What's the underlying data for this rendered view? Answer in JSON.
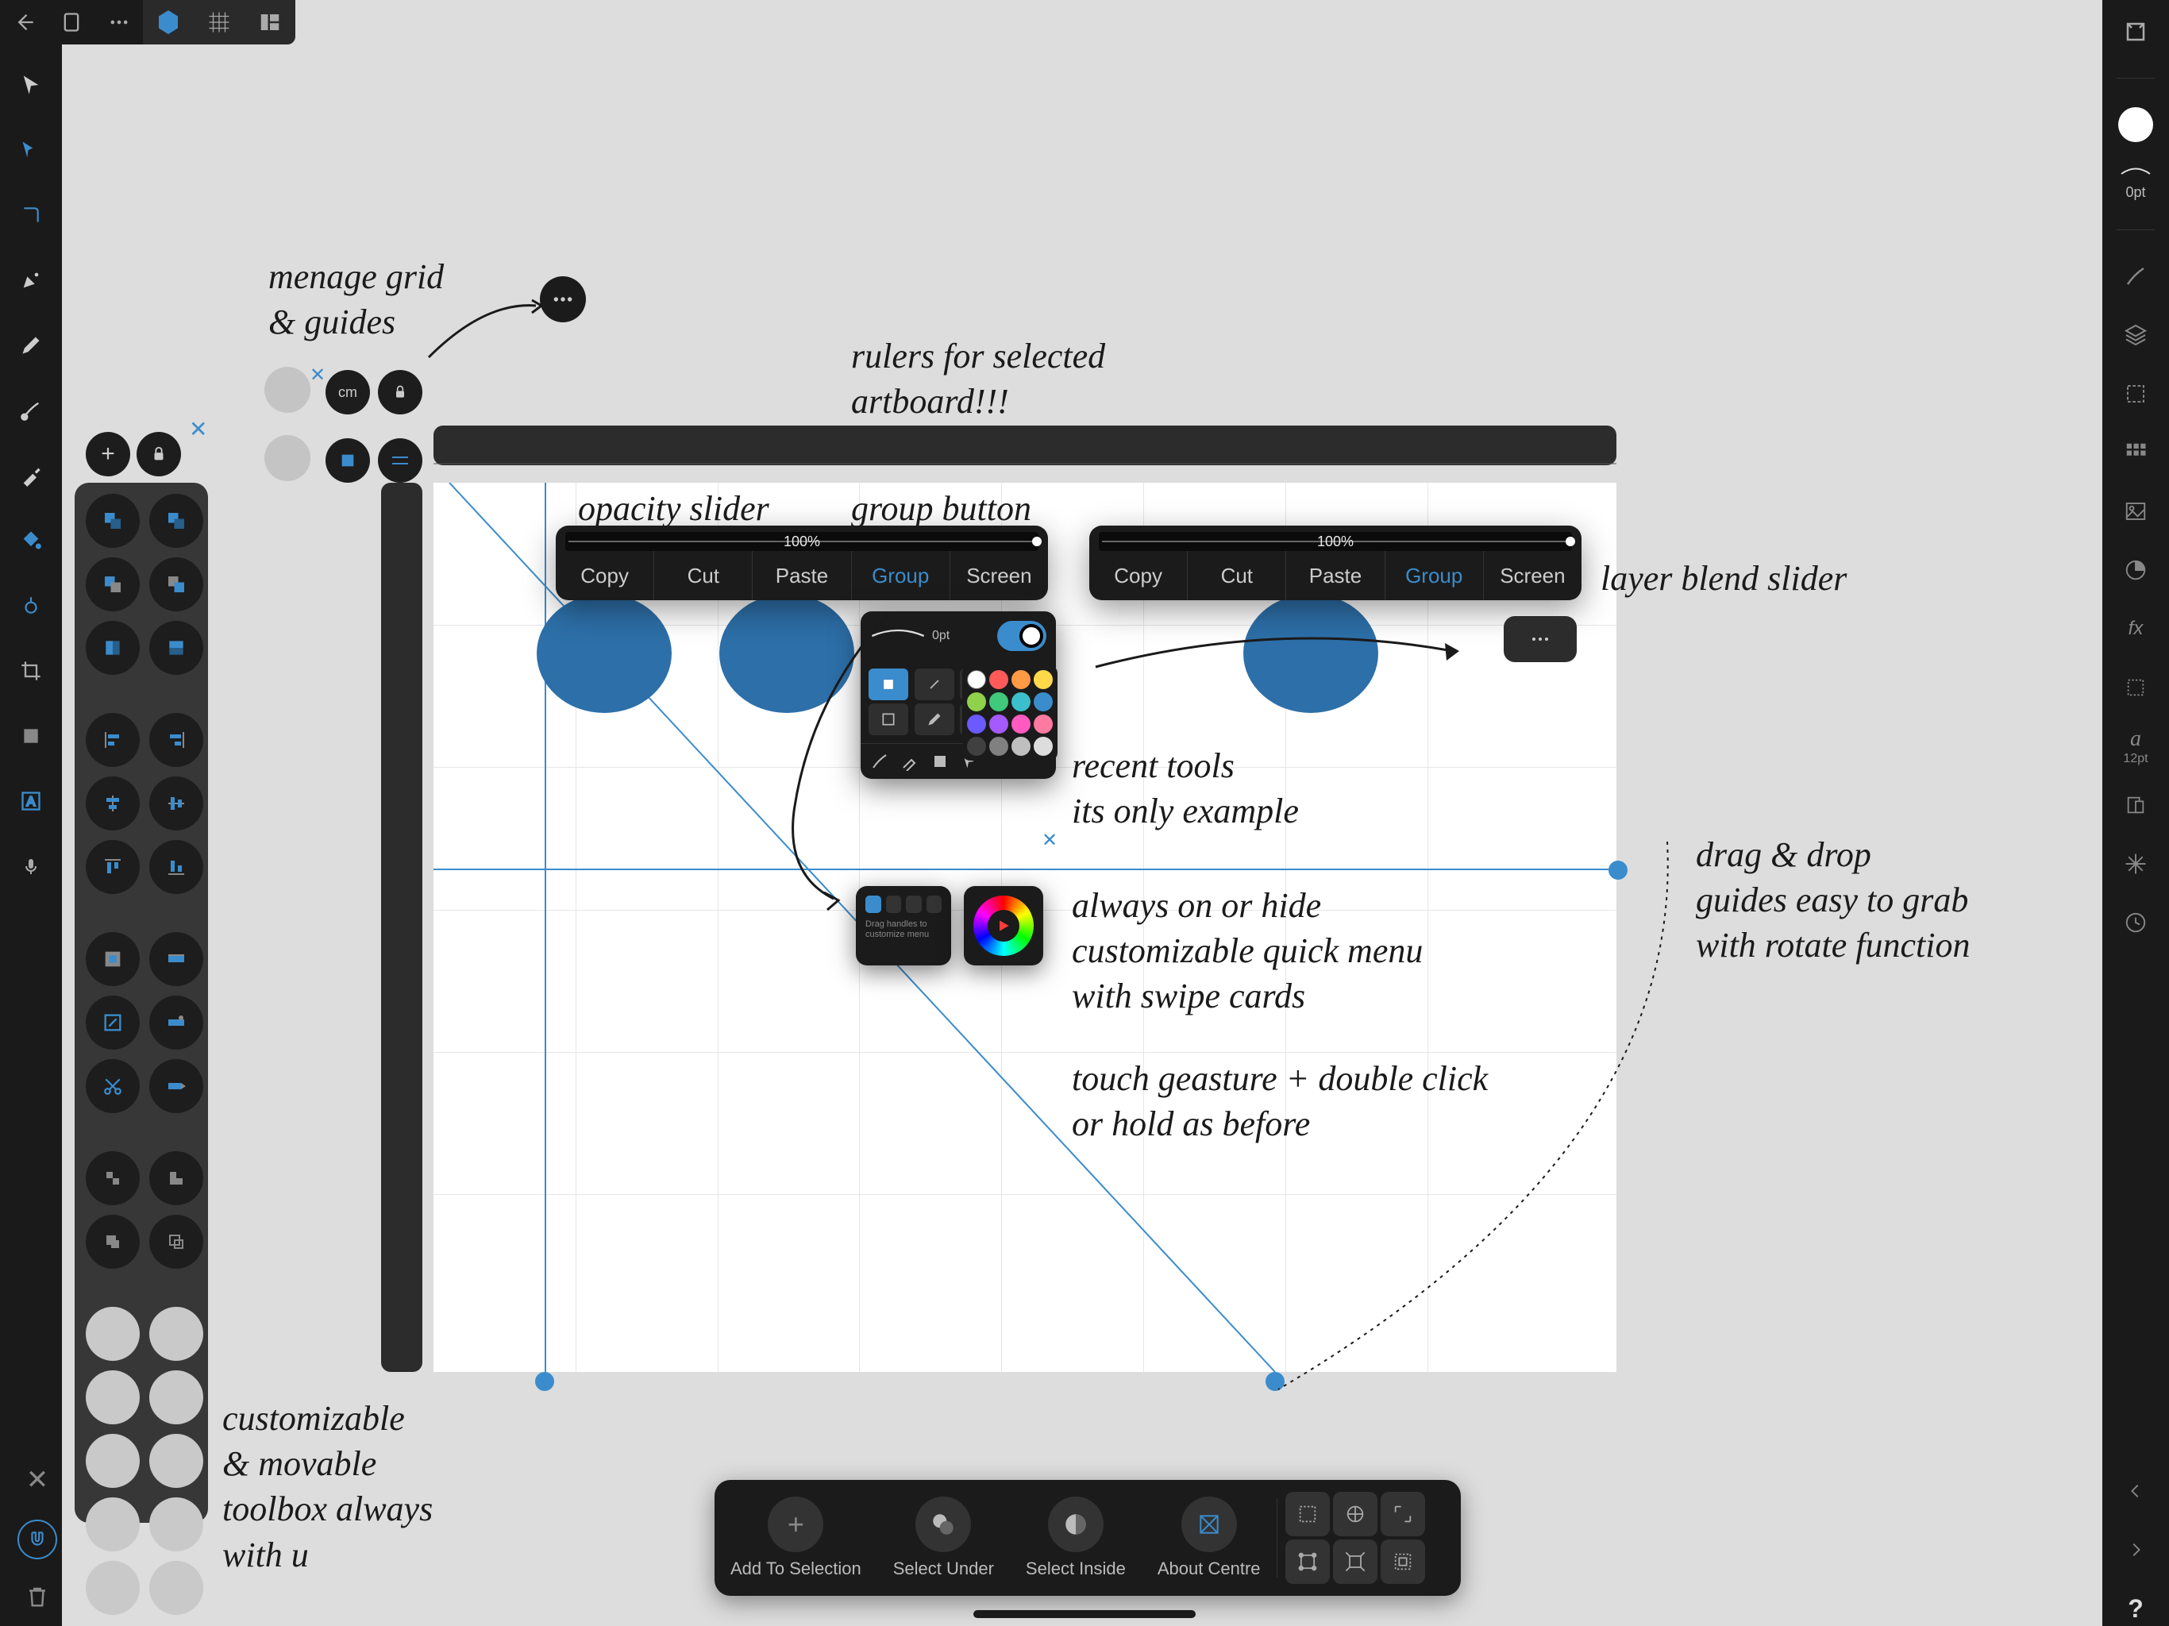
{
  "top": {
    "back_icon": "←"
  },
  "stroke_width": "0pt",
  "font_size": "12pt",
  "context_bar_left": {
    "slider_pct": "100%",
    "copy": "Copy",
    "cut": "Cut",
    "paste": "Paste",
    "group": "Group",
    "screen": "Screen"
  },
  "context_bar_right": {
    "slider_pct": "100%",
    "copy": "Copy",
    "cut": "Cut",
    "paste": "Paste",
    "group": "Group",
    "screen": "Screen"
  },
  "quick_tools": {
    "stroke_lbl": "0pt"
  },
  "annotations": {
    "grid": "menage grid\n& guides",
    "rulers": "rulers for selected\nartboard!!!",
    "opacity": "opacity slider",
    "group_btn": "group button",
    "layer_blend": "layer blend slider",
    "recent": "recent tools\nits only example",
    "quick_menu": "always on or hide\ncustomizable quick menu\nwith swipe cards",
    "gesture": "touch geasture + double click\nor hold as before",
    "guides": "drag & drop\nguides easy to grab\nwith rotate function",
    "toolbox": "customizable\n& movable\ntoolbox always\nwith u"
  },
  "selection_bar": {
    "add": "Add To Selection",
    "under": "Select Under",
    "inside": "Select Inside",
    "centre": "About Centre"
  },
  "grid_pills": {
    "cm": "cm"
  },
  "colors": {
    "accent": "#3b8ccc",
    "blob": "#2d6fa8",
    "panel": "#1b1b1b",
    "swatches": [
      "#ffffff",
      "#ff5a5a",
      "#ff9a45",
      "#ffd94a",
      "#8fd14a",
      "#40c97b",
      "#3bbfcc",
      "#3b8ccc",
      "#6a5aff",
      "#a45aff",
      "#ff5abf",
      "#ff7aa0",
      "#404040",
      "#808080",
      "#bfbfbf",
      "#dddddd"
    ]
  }
}
